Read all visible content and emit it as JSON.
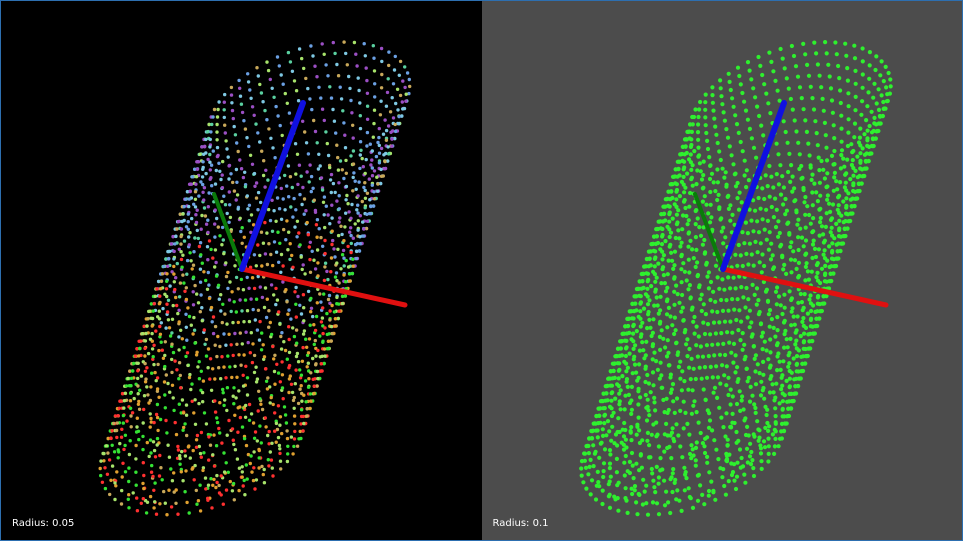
{
  "viewports": [
    {
      "caption": "Radius: 0.05",
      "background": "#000000",
      "coloring": "multicolor",
      "palette": [
        "#7ec8e3",
        "#9b4fc4",
        "#a7e36b",
        "#6ba0e3",
        "#c8a85a",
        "#ff3030",
        "#34e234",
        "#e0a030",
        "#5ad0a0"
      ]
    },
    {
      "caption": "Radius: 0.1",
      "background": "#4c4c4c",
      "coloring": "single",
      "palette": [
        "#2ef02e"
      ]
    }
  ],
  "axes": {
    "x_color": "#e01010",
    "y_color": "#0a7a0a",
    "z_color": "#1010e0"
  }
}
